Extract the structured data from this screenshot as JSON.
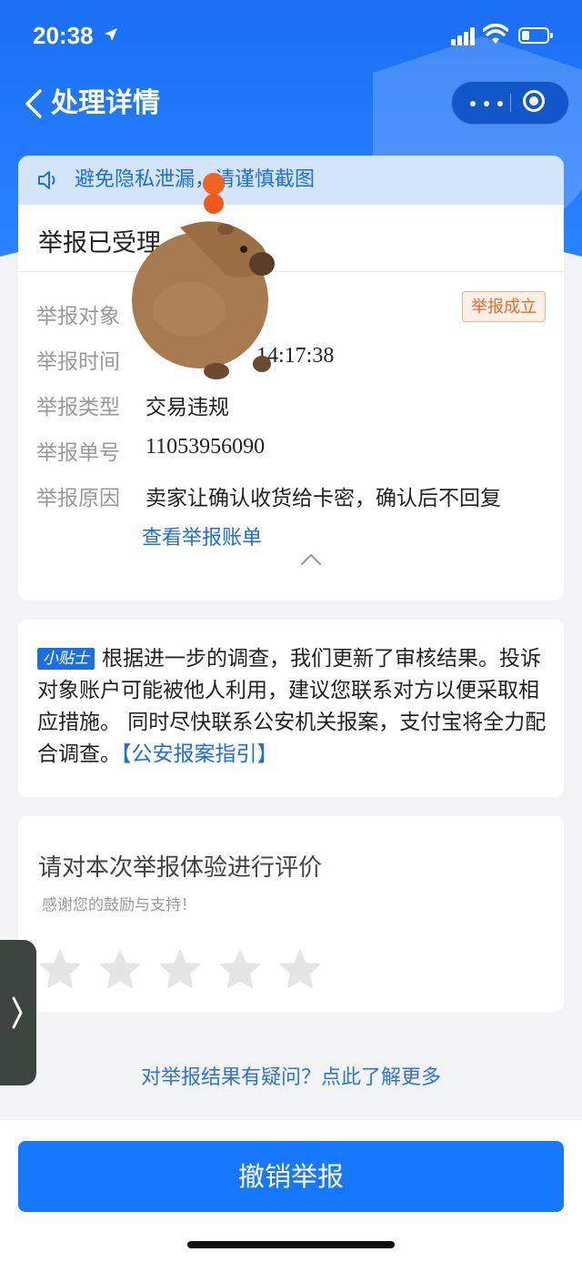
{
  "status_bar": {
    "time": "20:38"
  },
  "nav": {
    "title": "处理详情"
  },
  "notice": {
    "text": "避免隐私泄漏，请谨慎截图"
  },
  "report": {
    "title": "举报已受理",
    "status_badge": "举报成立",
    "rows": [
      {
        "label": "举报对象",
        "value": ""
      },
      {
        "label": "举报时间",
        "value": "14:17:38"
      },
      {
        "label": "举报类型",
        "value": "交易违规"
      },
      {
        "label": "举报单号",
        "value": "11053956090"
      },
      {
        "label": "举报原因",
        "value": "卖家让确认收货给卡密，确认后不回复"
      }
    ],
    "view_bill_link": "查看举报账单"
  },
  "tips": {
    "tag": "小贴士",
    "text": "根据进一步的调查，我们更新了审核结果。投诉对象账户可能被他人利用，建议您联系对方以便采取相应措施。 同时尽快联系公安机关报案，支付宝将全力配合调查。",
    "link": "【公安报案指引】"
  },
  "rating": {
    "title": "请对本次举报体验进行评价",
    "subtitle": "感谢您的鼓励与支持！",
    "stars_selected": 0,
    "stars_total": 5
  },
  "faq_link": "对举报结果有疑问？点此了解更多",
  "revoke_button": "撤销举报",
  "colors": {
    "primary": "#1677ff",
    "badge": "#e76a2d",
    "link": "#1c6fe0"
  }
}
